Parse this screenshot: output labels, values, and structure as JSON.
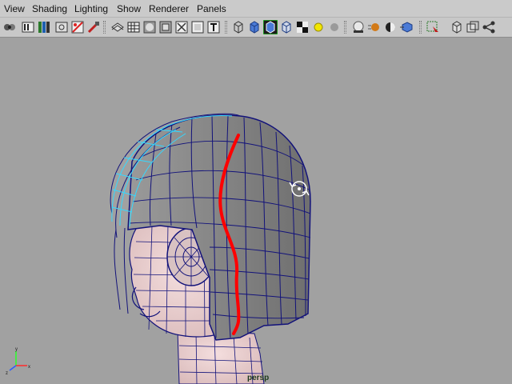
{
  "menu": {
    "items": [
      "View",
      "Shading",
      "Lighting",
      "Show",
      "Renderer",
      "Panels"
    ]
  },
  "toolbar": {
    "icons": [
      "camera-attributes-icon",
      "bookmark-icon",
      "image-plane-icon",
      "film-gate-icon",
      "grease-pencil-icon",
      "texture-brush-icon",
      "isolate-select-icon",
      "grid-icon",
      "film-gate-mask-icon",
      "resolution-gate-icon",
      "safe-action-icon",
      "safe-title-icon",
      "wireframe-icon",
      "smooth-shade-icon",
      "wireframe-on-shaded-icon",
      "default-material-icon",
      "textured-icon",
      "use-lights-icon",
      "shadows-icon",
      "screen-space-ao-icon",
      "motion-blur-icon",
      "anti-aliasing-icon",
      "isolate-select-view-icon",
      "xray-icon",
      "xray-joints-icon",
      "xray-components-icon"
    ]
  },
  "viewport": {
    "camera_name": "persp",
    "background_color": "#a1a1a1",
    "highlight_color": "#ff0000",
    "wire_color": "#10107a",
    "selected_wire_color": "#35d8ff"
  }
}
